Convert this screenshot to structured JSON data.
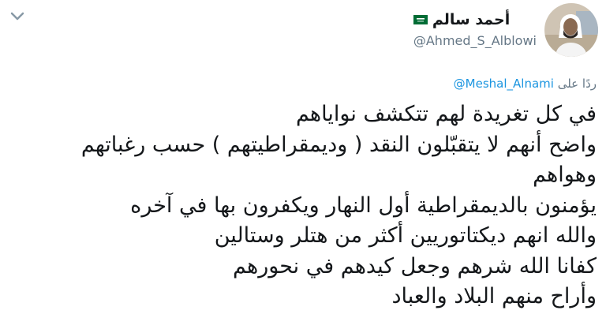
{
  "author": {
    "display_name": "أحمد سالم",
    "handle": "@Ahmed_S_Alblowi",
    "flag_icon": "saudi-flag-icon",
    "avatar_icon": "profile-avatar"
  },
  "reply": {
    "prefix": "ردًا على",
    "target": "@Meshal_Alnami"
  },
  "tweet": {
    "lines": [
      "في كل تغريدة لهم تتكشف نواياهم",
      "واضح أنهم لا يتقبّلون النقد ( وديمقراطيتهم ) حسب رغباتهم",
      "وهواهم",
      "يؤمنون بالديمقراطية أول النهار ويكفرون بها في آخره",
      "والله انهم ديكتاتوريين أكثر من هتلر وستالين",
      "كفانا الله شرهم وجعل كيدهم في نحورهم",
      "وأراح منهم البلاد والعباد"
    ]
  },
  "colors": {
    "handle_gray": "#657786",
    "link_blue": "#1b95e0",
    "text": "#14171a",
    "flag_green": "#006c35"
  }
}
